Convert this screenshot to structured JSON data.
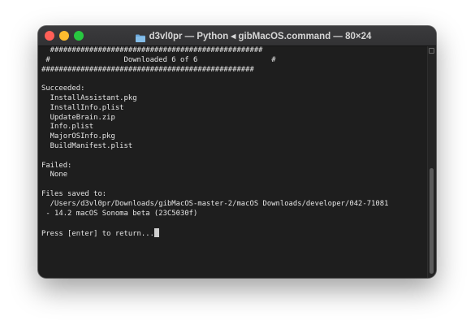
{
  "window": {
    "title": "d3vl0pr — Python ◂ gibMacOS.command — 80×24",
    "icon": "folder-icon"
  },
  "terminal": {
    "lines": [
      "  #################################################",
      " #                 Downloaded 6 of 6                 #",
      "#################################################",
      "",
      "Succeeded:",
      "  InstallAssistant.pkg",
      "  InstallInfo.plist",
      "  UpdateBrain.zip",
      "  Info.plist",
      "  MajorOSInfo.pkg",
      "  BuildManifest.plist",
      "",
      "Failed:",
      "  None",
      "",
      "Files saved to:",
      "  /Users/d3vl0pr/Downloads/gibMacOS-master-2/macOS Downloads/developer/042-71081",
      " - 14.2 macOS Sonoma beta (23C5030f)",
      "",
      "Press [enter] to return..."
    ]
  },
  "colors": {
    "close": "#ff5f57",
    "minimize": "#febc2e",
    "zoom": "#28c840",
    "background": "#1e1e1e",
    "text": "#e6e6e6"
  }
}
